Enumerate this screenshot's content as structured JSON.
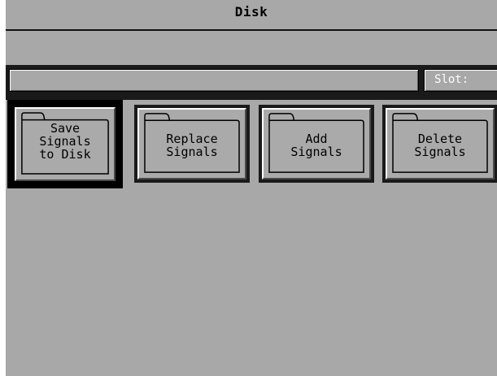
{
  "window": {
    "title": "Disk"
  },
  "status": {
    "name_value": "",
    "slot_label": "Slot:"
  },
  "buttons": [
    {
      "id": "save",
      "label": "Save\nSignals\nto Disk",
      "icon": "folder-icon",
      "selected": true
    },
    {
      "id": "replace",
      "label": "Replace\nSignals",
      "icon": "folder-icon",
      "selected": false
    },
    {
      "id": "add",
      "label": "Add\nSignals",
      "icon": "folder-icon",
      "selected": false
    },
    {
      "id": "delete",
      "label": "Delete\nSignals",
      "icon": "folder-icon",
      "selected": false
    }
  ],
  "colors": {
    "background": "#a8a8a8",
    "border_dark": "#1a1a1a",
    "highlight": "#ffffff",
    "shadow": "#4a4a4a",
    "slot_text": "#ffffff"
  }
}
